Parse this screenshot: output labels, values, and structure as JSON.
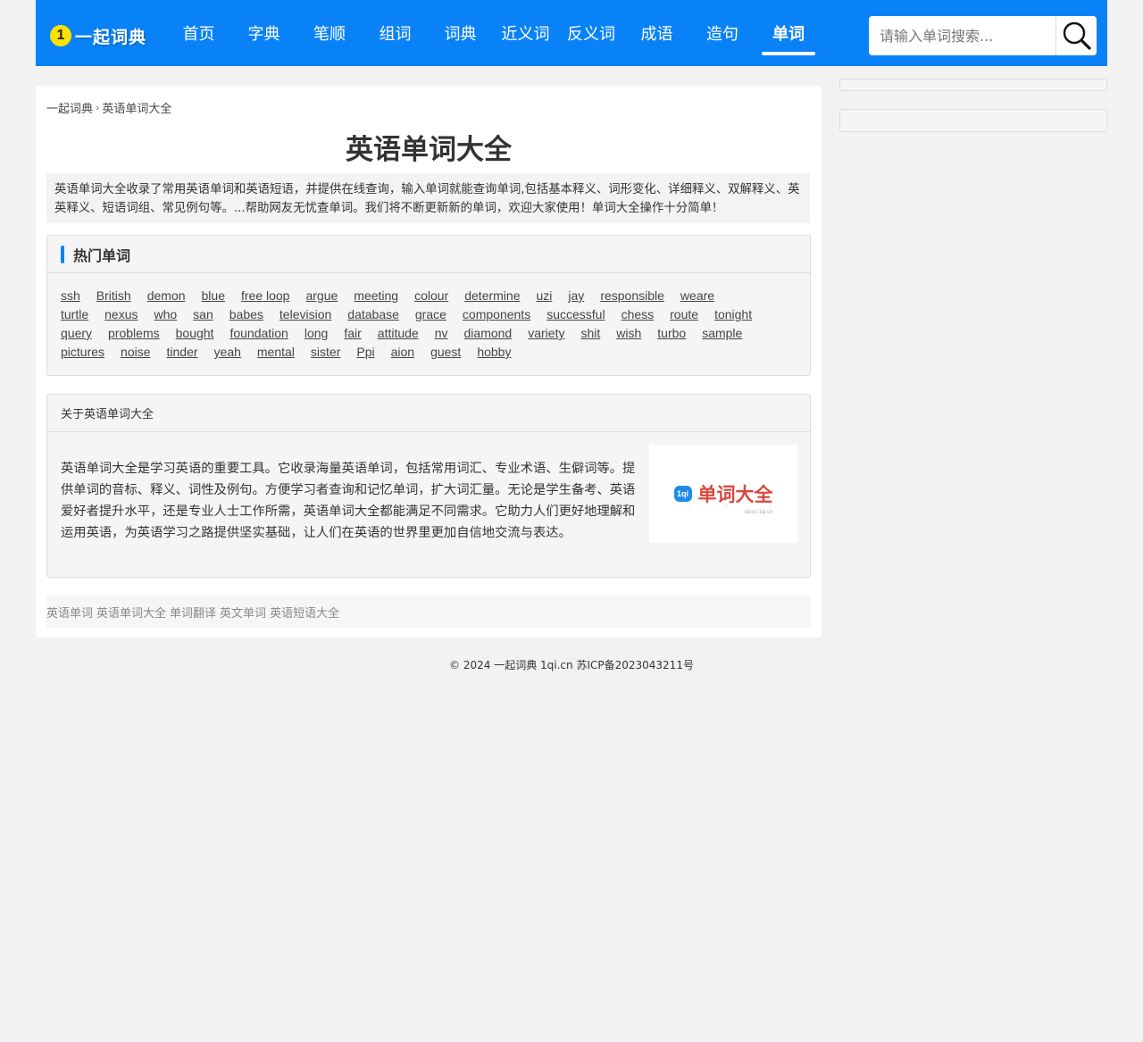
{
  "header": {
    "logo_badge": "1",
    "logo_text": "一起词典",
    "nav": [
      {
        "label": "首页",
        "name": "home"
      },
      {
        "label": "字典",
        "name": "zidian"
      },
      {
        "label": "笔顺",
        "name": "bishun"
      },
      {
        "label": "组词",
        "name": "zuci"
      },
      {
        "label": "词典",
        "name": "cidian"
      },
      {
        "label": "近义词",
        "name": "jinyici"
      },
      {
        "label": "反义词",
        "name": "fanyici"
      },
      {
        "label": "成语",
        "name": "chengyu"
      },
      {
        "label": "造句",
        "name": "zaoju"
      },
      {
        "label": "单词",
        "name": "danci",
        "active": true
      }
    ],
    "search": {
      "placeholder": "请输入单词搜索..."
    }
  },
  "breadcrumb": {
    "home": "一起词典",
    "sep": "›",
    "current": "英语单词大全"
  },
  "page_title": "英语单词大全",
  "intro": "英语单词大全收录了常用英语单词和英语短语，并提供在线查询，输入单词就能查询单词,包括基本释义、词形变化、详细释义、双解释义、英英释义、短语词组、常见例句等。...帮助网友无忧查单词。我们将不断更新新的单词，欢迎大家使用！单词大全操作十分简单！",
  "hot": {
    "title": "热门单词",
    "words": [
      "ssh",
      "British",
      "demon",
      "blue",
      "free loop",
      "argue",
      "meeting",
      "colour",
      "determine",
      "uzi",
      "jay",
      "responsible",
      "weare",
      "turtle",
      "nexus",
      "who",
      "san",
      "babes",
      "television",
      "database",
      "grace",
      "components",
      "successful",
      "chess",
      "route",
      "tonight",
      "query",
      "problems",
      "bought",
      "foundation",
      "long",
      "fair",
      "attitude",
      "nv",
      "diamond",
      "variety",
      "shit",
      "wish",
      "turbo",
      "sample",
      "pictures",
      "noise",
      "tinder",
      "yeah",
      "mental",
      "sister",
      "Ppi",
      "aion",
      "guest",
      "hobby"
    ]
  },
  "about": {
    "title": "关于英语单词大全",
    "text": "英语单词大全是学习英语的重要工具。它收录海量英语单词，包括常用词汇、专业术语、生僻词等。提供单词的音标、释义、词性及例句。方便学习者查询和记忆单词，扩大词汇量。无论是学生备考、英语爱好者提升水平，还是专业人士工作所需，英语单词大全都能满足不同需求。它助力人们更好地理解和运用英语，为英语学习之路提供坚实基础，让人们在英语的世界里更加自信地交流与表达。",
    "logo_icon": "1qi",
    "logo_word": "单词大全",
    "logo_domain": "danci.1qi.cn"
  },
  "tags": [
    "英语单词",
    "英语单词大全",
    "单词翻译",
    "英文单词",
    "英语短语大全"
  ],
  "footer": "© 2024 一起词典 1qi.cn 苏ICP备2023043211号",
  "colors": {
    "brand": "#0a82f7",
    "logo_badge": "#ffe100",
    "logo_accent": "#d9473f"
  }
}
